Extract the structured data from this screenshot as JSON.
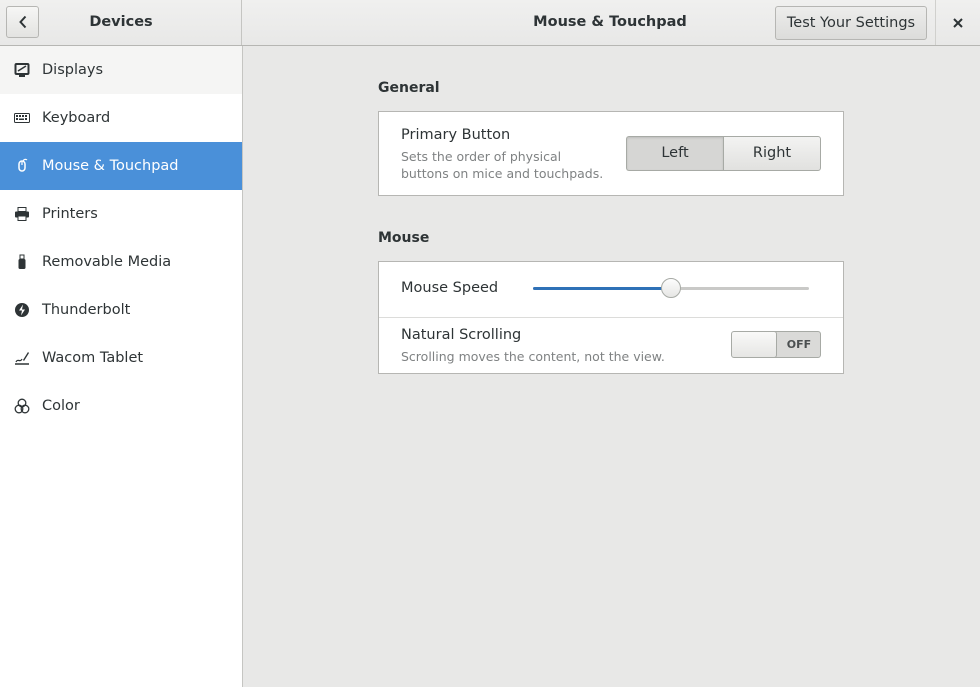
{
  "header": {
    "back_icon": "chevron-left-icon",
    "panel_title": "Devices",
    "title": "Mouse & Touchpad",
    "test_button": "Test Your Settings",
    "close_icon": "close-icon"
  },
  "sidebar": {
    "items": [
      {
        "label": "Displays",
        "icon": "display-icon"
      },
      {
        "label": "Keyboard",
        "icon": "keyboard-icon"
      },
      {
        "label": "Mouse & Touchpad",
        "icon": "mouse-icon",
        "selected": true
      },
      {
        "label": "Printers",
        "icon": "printer-icon"
      },
      {
        "label": "Removable Media",
        "icon": "usb-drive-icon"
      },
      {
        "label": "Thunderbolt",
        "icon": "thunderbolt-icon"
      },
      {
        "label": "Wacom Tablet",
        "icon": "tablet-pen-icon"
      },
      {
        "label": "Color",
        "icon": "color-icon"
      }
    ]
  },
  "general": {
    "section_title": "General",
    "primary_button": {
      "title": "Primary Button",
      "description": "Sets the order of physical buttons on mice and touchpads.",
      "left_label": "Left",
      "right_label": "Right",
      "selected": "Left"
    }
  },
  "mouse": {
    "section_title": "Mouse",
    "speed": {
      "title": "Mouse Speed",
      "value_fraction": 0.5
    },
    "natural_scrolling": {
      "title": "Natural Scrolling",
      "description": "Scrolling moves the content, not the view.",
      "state": "OFF"
    }
  },
  "colors": {
    "accent": "#4a90d9",
    "slider_fill": "#2f71b7"
  }
}
